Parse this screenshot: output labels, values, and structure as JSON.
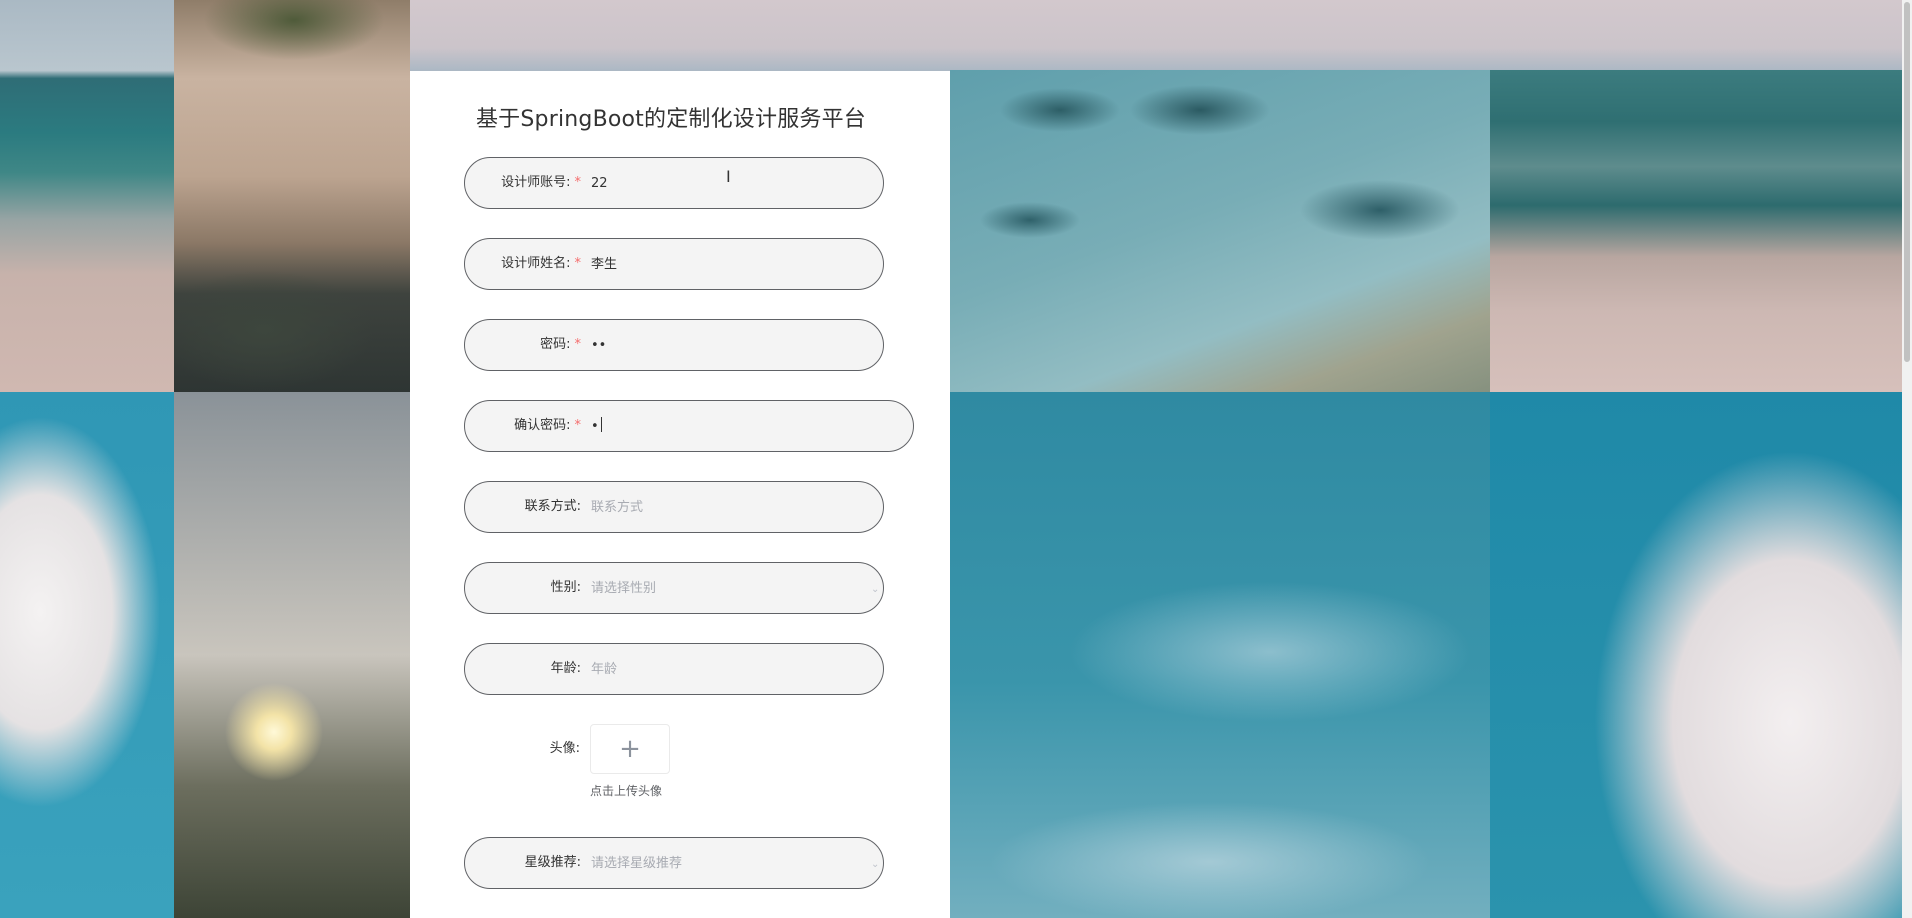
{
  "page_title": "基于SpringBoot的定制化设计服务平台",
  "form": {
    "designer_account": {
      "label": "设计师账号",
      "colon": ":",
      "required": "*",
      "value": "22"
    },
    "designer_name": {
      "label": "设计师姓名",
      "colon": ":",
      "required": "*",
      "value": "李生"
    },
    "password": {
      "label": "密码",
      "colon": ":",
      "required": "*",
      "value": "••"
    },
    "confirm_password": {
      "label": "确认密码",
      "colon": ":",
      "required": "*",
      "value": "•"
    },
    "contact": {
      "label": "联系方式",
      "colon": ":",
      "placeholder": "联系方式"
    },
    "gender": {
      "label": "性别",
      "colon": ":",
      "placeholder": "请选择性别"
    },
    "age": {
      "label": "年龄",
      "colon": ":",
      "placeholder": "年龄"
    },
    "avatar": {
      "label": "头像",
      "colon": ":",
      "upload_icon": "plus-icon",
      "hint": "点击上传头像"
    },
    "star_rating": {
      "label": "星级推荐",
      "colon": ":",
      "placeholder": "请选择星级推荐"
    }
  },
  "colors": {
    "required_mark": "#f56c6c",
    "field_border": "#606266",
    "field_bg": "#f4f4f4",
    "placeholder": "#a8abb2"
  }
}
